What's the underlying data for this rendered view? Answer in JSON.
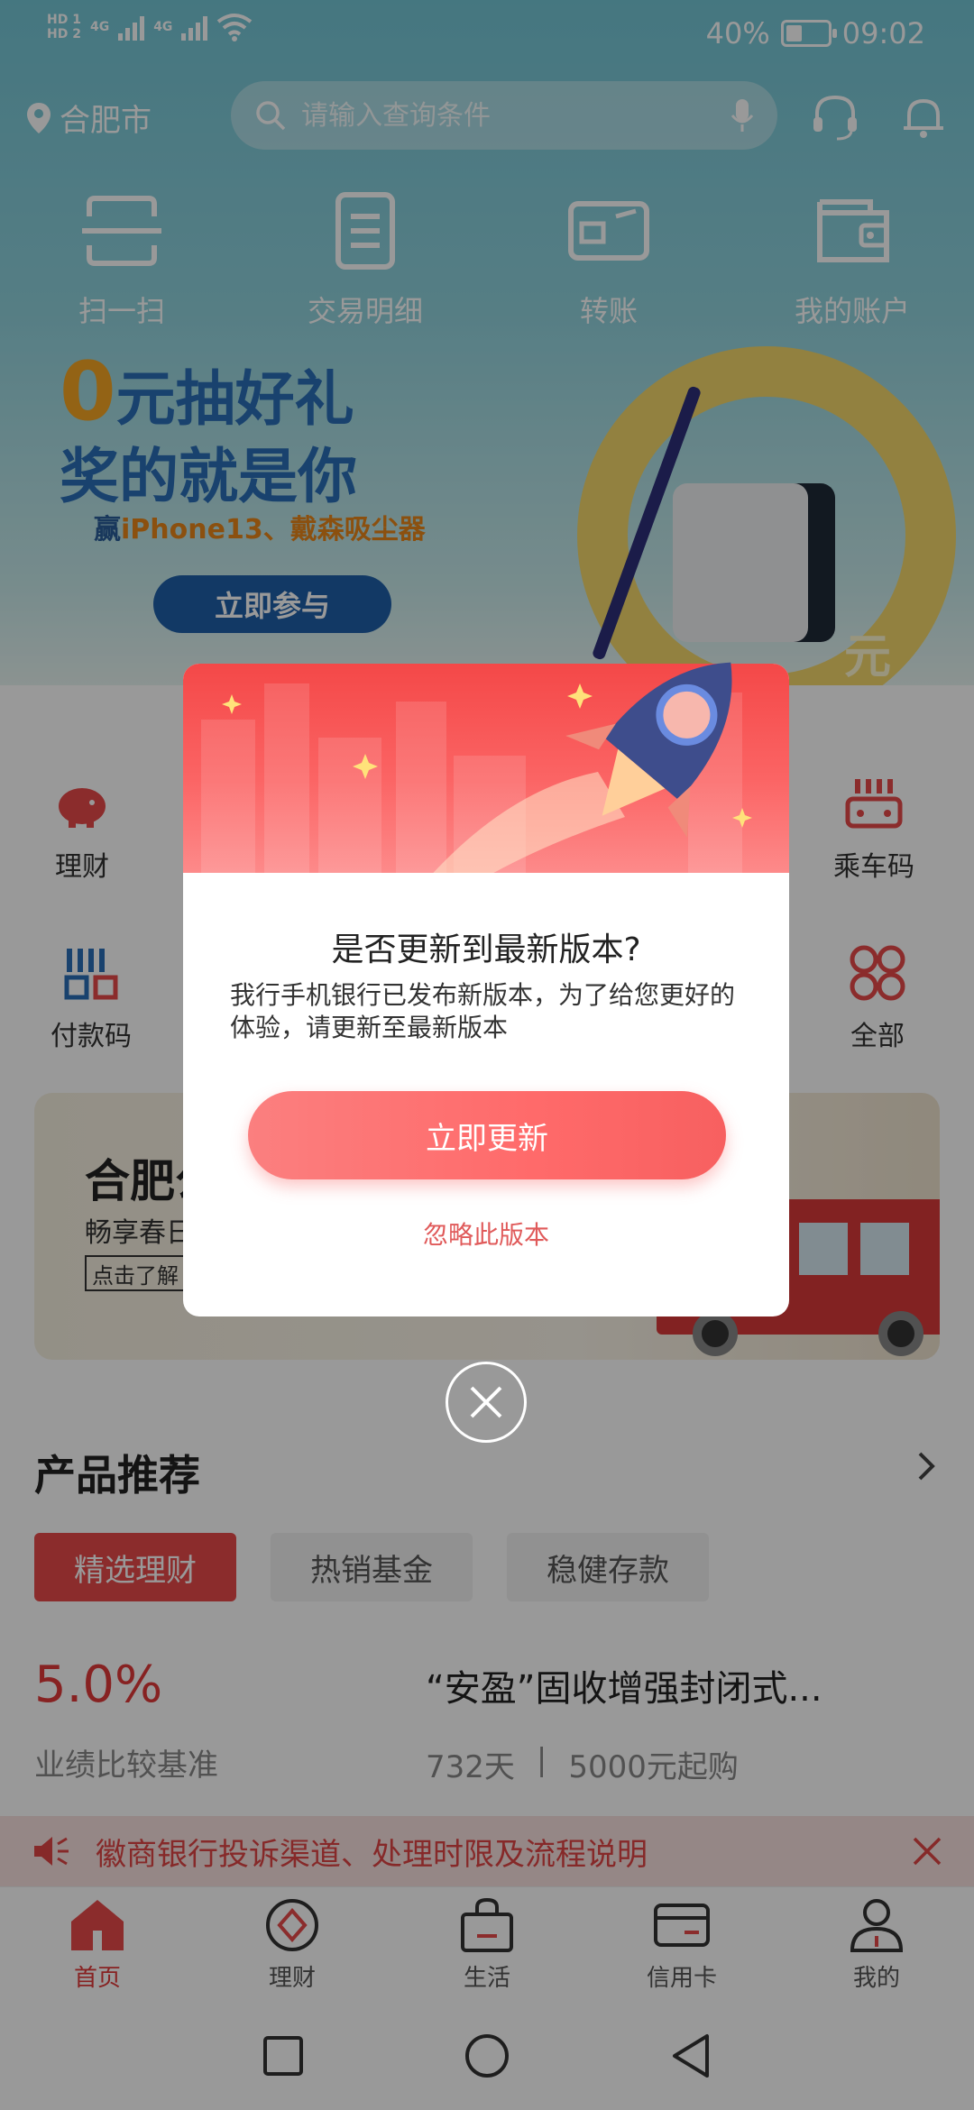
{
  "status_bar": {
    "hd1": "HD 1",
    "hd2": "HD 2",
    "net1": "4G",
    "net2": "4G",
    "battery_percent_text": "40%",
    "battery_level": 0.4,
    "time": "09:02"
  },
  "header": {
    "location": "合肥市",
    "search_placeholder": "请输入查询条件"
  },
  "quick_actions": [
    {
      "label": "扫一扫",
      "icon": "scan-icon"
    },
    {
      "label": "交易明细",
      "icon": "transaction-detail-icon"
    },
    {
      "label": "转账",
      "icon": "transfer-icon"
    },
    {
      "label": "我的账户",
      "icon": "wallet-icon"
    }
  ],
  "banner": {
    "zero": "0",
    "title_line1": "元抽好礼",
    "title_line2": "奖的就是你",
    "subtitle_prefix": "赢",
    "subtitle_highlight": "iPhone13、戴森吸尘器",
    "button": "立即参与",
    "corner_text": "元"
  },
  "services": [
    {
      "label": "理财",
      "icon": "piggy-bank-icon"
    },
    {
      "label": "乘车码",
      "icon": "transit-code-icon"
    },
    {
      "label": "付款码",
      "icon": "payment-code-icon"
    },
    {
      "label": "全部",
      "icon": "all-services-icon"
    }
  ],
  "promo": {
    "title": "合肥公",
    "subtitle": "畅享春日",
    "button": "点击了解"
  },
  "products": {
    "section_title": "产品推荐",
    "tabs": [
      "精选理财",
      "热销基金",
      "稳健存款"
    ],
    "rate": "5.0%",
    "rate_label": "业绩比较基准",
    "name": "“安盈”固收增强封闭式...",
    "term": "732天",
    "separator": "|",
    "min_buy": "5000元起购"
  },
  "notice": {
    "text": "徽商银行投诉渠道、处理时限及流程说明"
  },
  "tabbar": [
    {
      "label": "首页",
      "icon": "home-icon",
      "active": true
    },
    {
      "label": "理财",
      "icon": "finance-icon",
      "active": false
    },
    {
      "label": "生活",
      "icon": "shopping-bag-icon",
      "active": false
    },
    {
      "label": "信用卡",
      "icon": "credit-card-icon",
      "active": false
    },
    {
      "label": "我的",
      "icon": "profile-icon",
      "active": false
    }
  ],
  "dialog": {
    "title": "是否更新到最新版本?",
    "message": "我行手机银行已发布新版本，为了给您更好的体验，请更新至最新版本",
    "update_button": "立即更新",
    "ignore_link": "忽略此版本"
  },
  "colors": {
    "brand_red": "#e23a3a",
    "button_gradient_start": "#fb7f7f",
    "button_gradient_end": "#f76060",
    "hero_teal": "#74c6d6",
    "overlay": "rgba(0,0,0,0.40)"
  }
}
